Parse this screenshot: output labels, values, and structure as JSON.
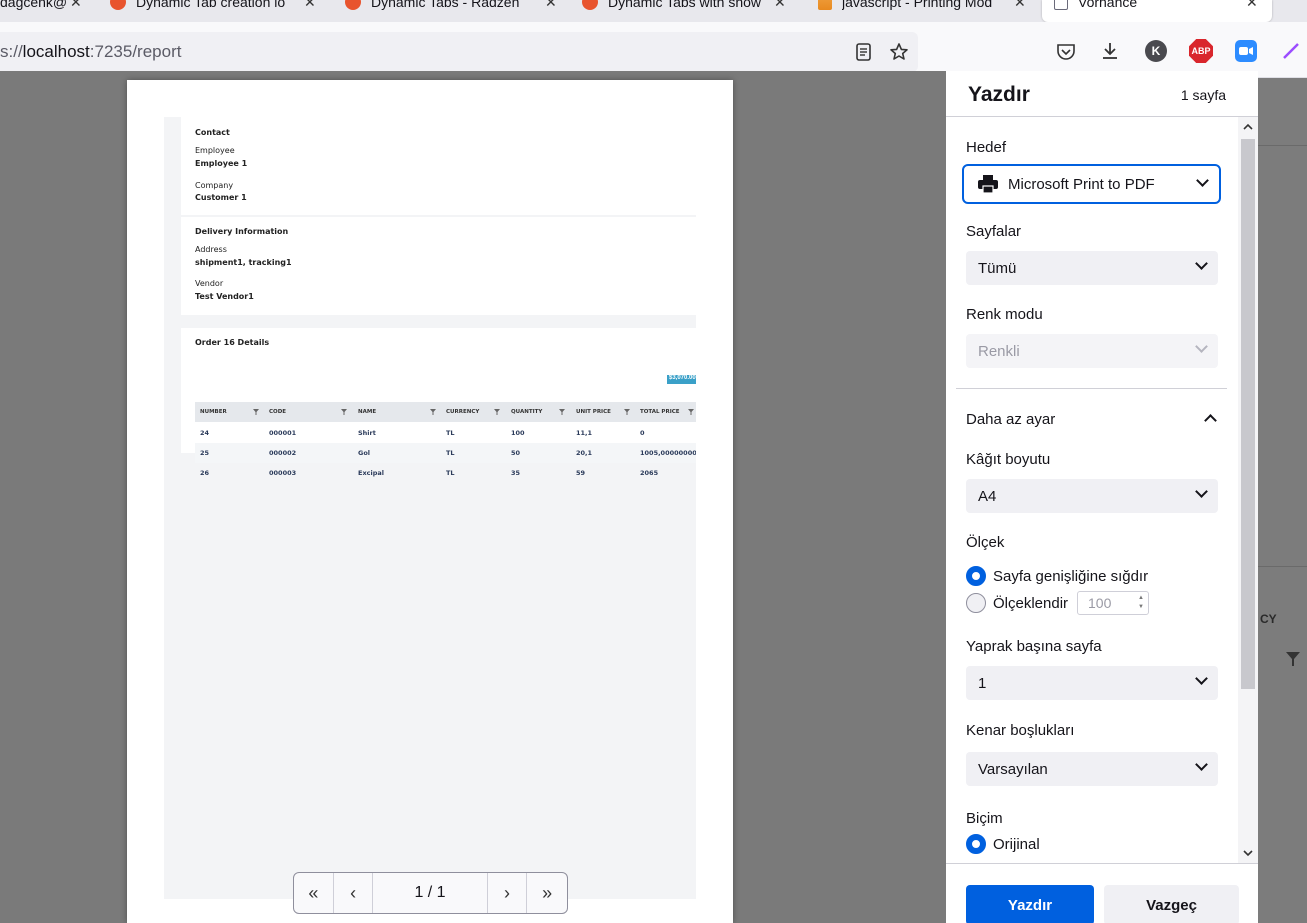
{
  "browser": {
    "tabs": [
      {
        "title": "dagcenk@"
      },
      {
        "title": "Dynamic Tab creation lo"
      },
      {
        "title": "Dynamic Tabs - Radzen"
      },
      {
        "title": "Dynamic Tabs with show"
      },
      {
        "title": "javascript - Printing Mod"
      },
      {
        "title": "Vorhance"
      }
    ],
    "url_scheme": "s://",
    "url_host": "localhost",
    "url_path": ":7235/report",
    "profile_initial": "K",
    "abp_label": "ABP"
  },
  "preview": {
    "contact_title": "Contact",
    "employee_label": "Employee",
    "employee_value": "Employee 1",
    "company_label": "Company",
    "company_value": "Customer 1",
    "delivery_title": "Delivery Information",
    "address_label": "Address",
    "address_value": "shipment1, tracking1",
    "vendor_label": "Vendor",
    "vendor_value": "Test Vendor1",
    "order_title": "Order 16 Details",
    "order_total_badge": "$3,070.00",
    "columns": [
      "NUMBER",
      "CODE",
      "NAME",
      "CURRENCY",
      "QUANTITY",
      "UNIT PRICE",
      "TOTAL PRICE"
    ],
    "rows": [
      [
        "24",
        "000001",
        "Shirt",
        "TL",
        "100",
        "11,1",
        "0"
      ],
      [
        "25",
        "000002",
        "Gol",
        "TL",
        "50",
        "20,1",
        "1005,00000000..."
      ],
      [
        "26",
        "000003",
        "Excipal",
        "TL",
        "35",
        "59",
        "2065"
      ]
    ],
    "pager_label": "1 / 1"
  },
  "print_panel": {
    "title": "Yazdır",
    "page_count": "1 sayfa",
    "destination_label": "Hedef",
    "destination_value": "Microsoft Print to PDF",
    "pages_label": "Sayfalar",
    "pages_value": "Tümü",
    "color_label": "Renk modu",
    "color_value": "Renkli",
    "less_settings": "Daha az ayar",
    "paper_label": "Kâğıt boyutu",
    "paper_value": "A4",
    "scale_label": "Ölçek",
    "scale_fit": "Sayfa genişliğine sığdır",
    "scale_custom": "Ölçeklendir",
    "scale_value": "100",
    "pages_per_sheet_label": "Yaprak başına sayfa",
    "pages_per_sheet_value": "1",
    "margins_label": "Kenar boşlukları",
    "margins_value": "Varsayılan",
    "format_label": "Biçim",
    "format_original": "Orijinal",
    "print_button": "Yazdır",
    "cancel_button": "Vazgeç"
  },
  "background_peek": {
    "text": "CY"
  }
}
